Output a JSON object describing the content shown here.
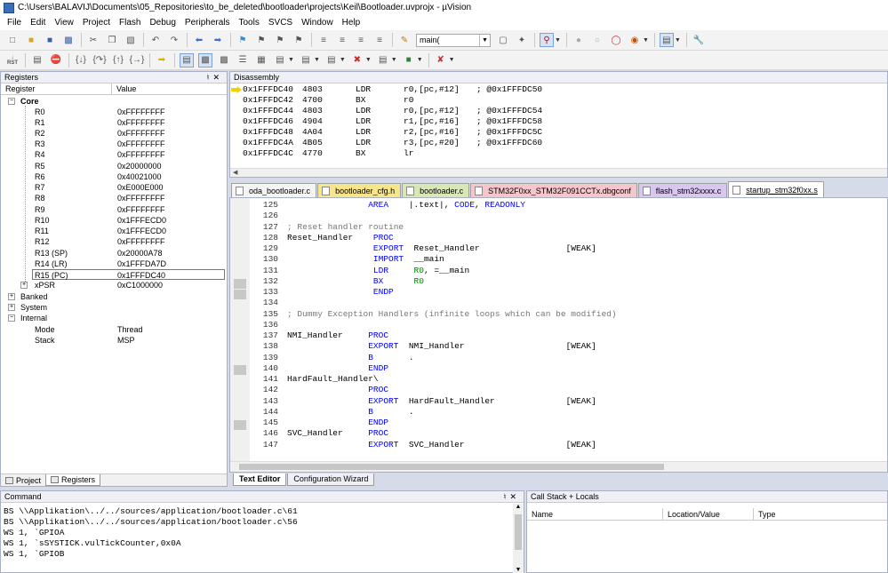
{
  "window": {
    "title": "C:\\Users\\BALAVIJ\\Documents\\05_Repositories\\to_be_deleted\\bootloader\\projects\\Keil\\Bootloader.uvprojx - µVision"
  },
  "menu": [
    "File",
    "Edit",
    "View",
    "Project",
    "Flash",
    "Debug",
    "Peripherals",
    "Tools",
    "SVCS",
    "Window",
    "Help"
  ],
  "toolbar": {
    "function_combo": "main(",
    "rst_label": "RST"
  },
  "registers": {
    "title": "Registers",
    "col_register": "Register",
    "col_value": "Value",
    "core_label": "Core",
    "core": [
      {
        "name": "R0",
        "value": "0xFFFFFFFF"
      },
      {
        "name": "R1",
        "value": "0xFFFFFFFF"
      },
      {
        "name": "R2",
        "value": "0xFFFFFFFF"
      },
      {
        "name": "R3",
        "value": "0xFFFFFFFF"
      },
      {
        "name": "R4",
        "value": "0xFFFFFFFF"
      },
      {
        "name": "R5",
        "value": "0x20000000"
      },
      {
        "name": "R6",
        "value": "0x40021000"
      },
      {
        "name": "R7",
        "value": "0xE000E000"
      },
      {
        "name": "R8",
        "value": "0xFFFFFFFF"
      },
      {
        "name": "R9",
        "value": "0xFFFFFFFF"
      },
      {
        "name": "R10",
        "value": "0x1FFFECD0"
      },
      {
        "name": "R11",
        "value": "0x1FFFECD0"
      },
      {
        "name": "R12",
        "value": "0xFFFFFFFF"
      },
      {
        "name": "R13 (SP)",
        "value": "0x20000A78"
      },
      {
        "name": "R14 (LR)",
        "value": "0x1FFFDA7D"
      },
      {
        "name": "R15 (PC)",
        "value": "0x1FFFDC40"
      },
      {
        "name": "xPSR",
        "value": "0xC1000000"
      }
    ],
    "banked_label": "Banked",
    "system_label": "System",
    "internal_label": "Internal",
    "internal": [
      {
        "name": "Mode",
        "value": "Thread"
      },
      {
        "name": "Stack",
        "value": "MSP"
      }
    ],
    "tab_project": "Project",
    "tab_registers": "Registers"
  },
  "disassembly": {
    "title": "Disassembly",
    "lines": [
      {
        "addr": "0x1FFFDC40",
        "op": "4803",
        "mn": "LDR",
        "args": "r0,[pc,#12]",
        "cmt": "; @0x1FFFDC50"
      },
      {
        "addr": "0x1FFFDC42",
        "op": "4700",
        "mn": "BX",
        "args": "r0",
        "cmt": ""
      },
      {
        "addr": "0x1FFFDC44",
        "op": "4803",
        "mn": "LDR",
        "args": "r0,[pc,#12]",
        "cmt": "; @0x1FFFDC54"
      },
      {
        "addr": "0x1FFFDC46",
        "op": "4904",
        "mn": "LDR",
        "args": "r1,[pc,#16]",
        "cmt": "; @0x1FFFDC58"
      },
      {
        "addr": "0x1FFFDC48",
        "op": "4A04",
        "mn": "LDR",
        "args": "r2,[pc,#16]",
        "cmt": "; @0x1FFFDC5C"
      },
      {
        "addr": "0x1FFFDC4A",
        "op": "4B05",
        "mn": "LDR",
        "args": "r3,[pc,#20]",
        "cmt": "; @0x1FFFDC60"
      },
      {
        "addr": "0x1FFFDC4C",
        "op": "4770",
        "mn": "BX",
        "args": "lr",
        "cmt": ""
      }
    ]
  },
  "file_tabs": [
    {
      "label": "oda_bootloader.c",
      "color": "#f4f4f4"
    },
    {
      "label": "bootloader_cfg.h",
      "color": "#f6e58d"
    },
    {
      "label": "bootloader.c",
      "color": "#d8e6b8"
    },
    {
      "label": "STM32F0xx_STM32F091CCTx.dbgconf",
      "color": "#f5c6cb"
    },
    {
      "label": "flash_stm32xxxx.c",
      "color": "#d9c7f0"
    },
    {
      "label": "startup_stm32f0xx.s",
      "color": "#ffffff"
    }
  ],
  "editor": {
    "lines": [
      {
        "num": "125",
        "text": "                AREA    |.text|, CODE, READONLY"
      },
      {
        "num": "126",
        "text": ""
      },
      {
        "num": "127",
        "text": "; Reset handler routine"
      },
      {
        "num": "128",
        "text": "Reset_Handler    PROC"
      },
      {
        "num": "129",
        "text": "                 EXPORT  Reset_Handler                 [WEAK]"
      },
      {
        "num": "130",
        "text": "                 IMPORT  __main"
      },
      {
        "num": "131",
        "text": "                 LDR     R0, =__main"
      },
      {
        "num": "132",
        "text": "                 BX      R0"
      },
      {
        "num": "133",
        "text": "                 ENDP"
      },
      {
        "num": "134",
        "text": ""
      },
      {
        "num": "135",
        "text": "; Dummy Exception Handlers (infinite loops which can be modified)"
      },
      {
        "num": "136",
        "text": ""
      },
      {
        "num": "137",
        "text": "NMI_Handler     PROC"
      },
      {
        "num": "138",
        "text": "                EXPORT  NMI_Handler                    [WEAK]"
      },
      {
        "num": "139",
        "text": "                B       ."
      },
      {
        "num": "140",
        "text": "                ENDP"
      },
      {
        "num": "141",
        "text": "HardFault_Handler\\"
      },
      {
        "num": "142",
        "text": "                PROC"
      },
      {
        "num": "143",
        "text": "                EXPORT  HardFault_Handler              [WEAK]"
      },
      {
        "num": "144",
        "text": "                B       ."
      },
      {
        "num": "145",
        "text": "                ENDP"
      },
      {
        "num": "146",
        "text": "SVC_Handler     PROC"
      },
      {
        "num": "147",
        "text": "                EXPORT  SVC_Handler                    [WEAK]"
      }
    ],
    "tab_text_editor": "Text Editor",
    "tab_config_wizard": "Configuration Wizard"
  },
  "command": {
    "title": "Command",
    "lines": [
      "BS \\\\Applikation\\../../sources/application/bootloader.c\\61",
      "BS \\\\Applikation\\../../sources/application/bootloader.c\\56",
      "WS 1, `GPIOA",
      "WS 1, `sSYSTICK.vulTickCounter,0x0A",
      "WS 1, `GPIOB"
    ]
  },
  "callstack": {
    "title": "Call Stack + Locals",
    "col_name": "Name",
    "col_location": "Location/Value",
    "col_type": "Type"
  }
}
